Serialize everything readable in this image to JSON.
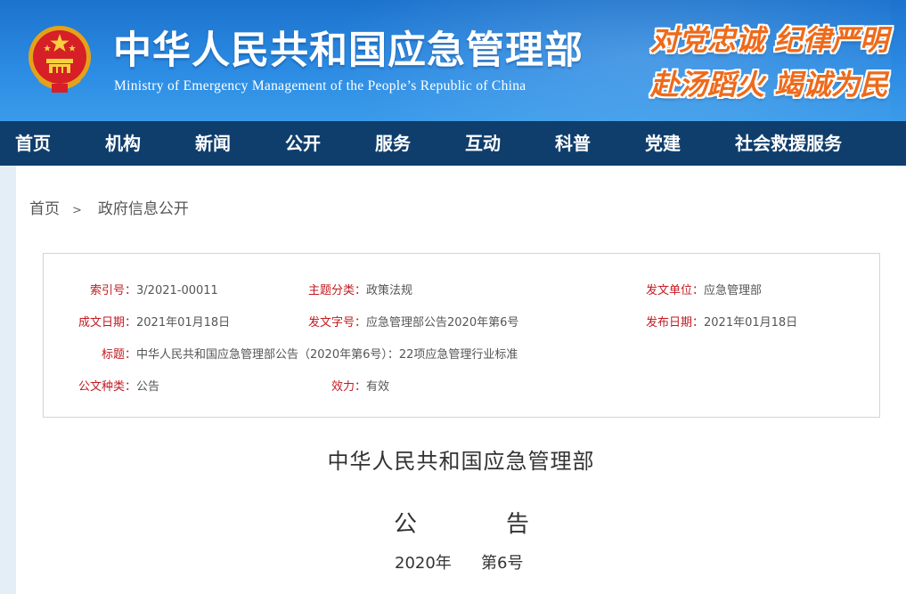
{
  "header": {
    "title": "中华人民共和国应急管理部",
    "subtitle": "Ministry of Emergency Management of the People’s Republic of China",
    "slogan_line1": "对党忠诚 纪律严明",
    "slogan_line2": "赴汤蹈火 竭诚为民",
    "emblem_icon": "national-emblem-icon"
  },
  "nav": {
    "items": [
      "首页",
      "机构",
      "新闻",
      "公开",
      "服务",
      "互动",
      "科普",
      "党建",
      "社会救援服务"
    ]
  },
  "breadcrumb": {
    "home": "首页",
    "separator": ">",
    "current": "政府信息公开"
  },
  "meta": {
    "index_label": "索引号：",
    "index_value": "3/2021-00011",
    "topic_label": "主题分类：",
    "topic_value": "政策法规",
    "issuer_label": "发文单位：",
    "issuer_value": "应急管理部",
    "created_label": "成文日期：",
    "created_value": "2021年01月18日",
    "docno_label": "发文字号：",
    "docno_value": "应急管理部公告2020年第6号",
    "published_label": "发布日期：",
    "published_value": "2021年01月18日",
    "title_label": "标题：",
    "title_value": "中华人民共和国应急管理部公告（2020年第6号）：22项应急管理行业标准",
    "type_label": "公文种类：",
    "type_value": "公告",
    "validity_label": "效力：",
    "validity_value": "有效"
  },
  "document": {
    "heading": "中华人民共和国应急管理部",
    "gong": "公",
    "gao": "告",
    "year": "2020年",
    "number": "第6号"
  },
  "colors": {
    "header_blue": "#2b8ae2",
    "nav_navy": "#0f3e6c",
    "label_red": "#c2191f",
    "slogan_orange": "#ee6a1a"
  }
}
